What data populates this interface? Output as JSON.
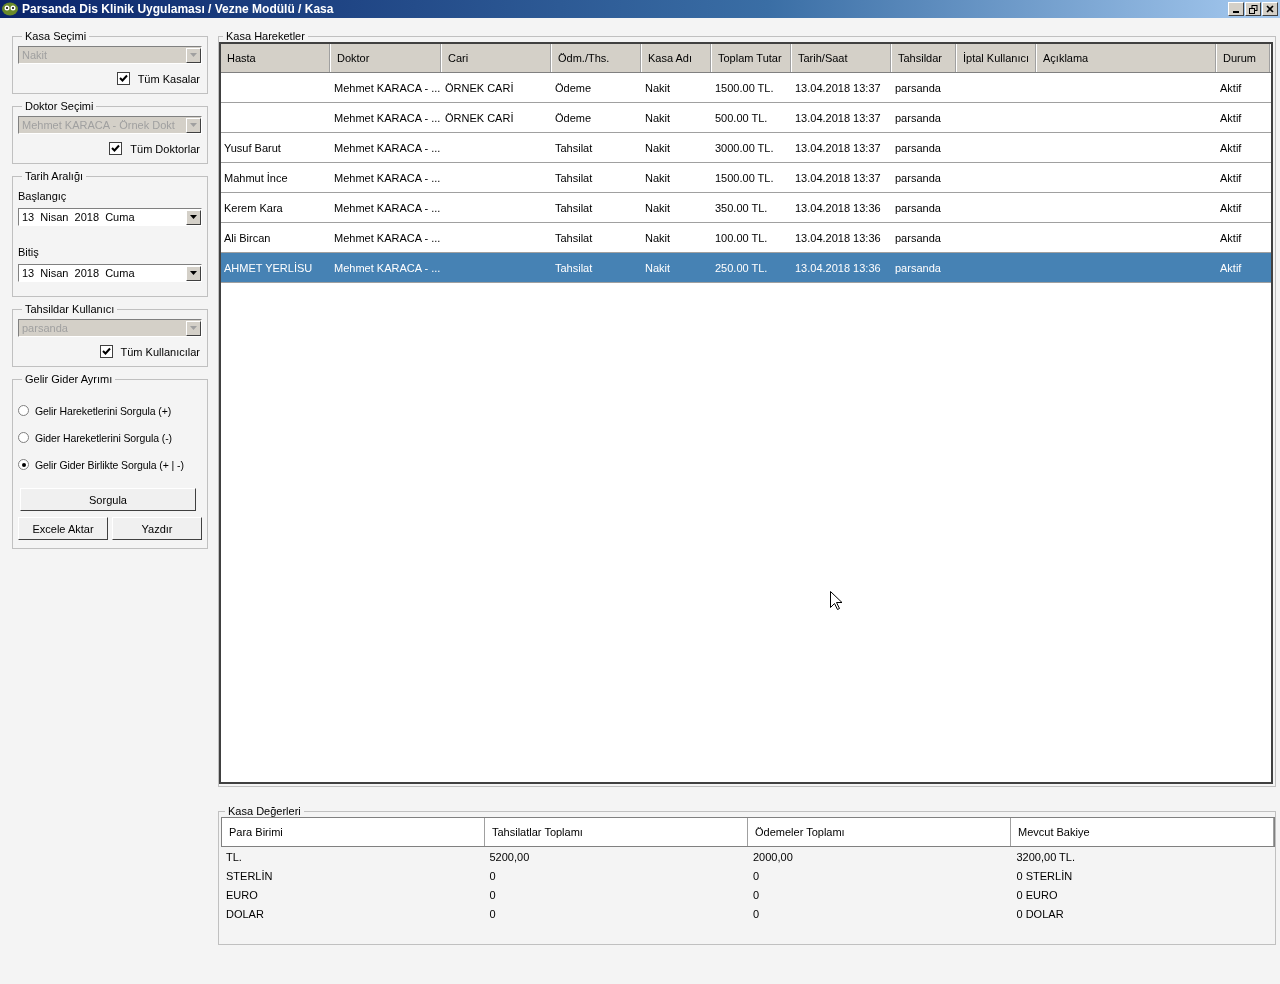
{
  "window": {
    "title": "Parsanda Dis Klinik Uygulaması / Vezne Modülü / Kasa"
  },
  "filter_groups": [
    {
      "kind": "select",
      "legend": "Kasa Seçimi",
      "value": "Nakit",
      "disabled": true,
      "checkbox": {
        "label": "Tüm Kasalar",
        "checked": true
      }
    },
    {
      "kind": "select",
      "legend": "Doktor Seçimi",
      "value": "Mehmet KARACA - Örnek Dokt",
      "disabled": true,
      "checkbox": {
        "label": "Tüm Doktorlar",
        "checked": true
      }
    },
    {
      "kind": "dates",
      "legend": "Tarih Aralığı",
      "fields": [
        {
          "label": "Başlangıç",
          "value": "13  Nisan  2018  Cuma"
        },
        {
          "label": "Bitiş",
          "value": "13  Nisan  2018  Cuma"
        }
      ]
    },
    {
      "kind": "select",
      "legend": "Tahsildar Kullanıcı",
      "value": "parsanda",
      "disabled": true,
      "checkbox": {
        "label": "Tüm Kullanıcılar",
        "checked": true
      }
    },
    {
      "kind": "radios",
      "legend": "Gelir Gider Ayrımı",
      "options": [
        {
          "label": "Gelir Hareketlerini Sorgula (+)",
          "selected": false
        },
        {
          "label": "Gider Hareketlerini Sorgula (-)",
          "selected": false
        },
        {
          "label": "Gelir Gider Birlikte Sorgula (+ | -)",
          "selected": true
        }
      ],
      "primary_button": "Sorgula",
      "buttons": [
        "Excele Aktar",
        "Yazdır"
      ]
    }
  ],
  "movements": {
    "legend": "Kasa Hareketler",
    "columns": [
      "Hasta",
      "Doktor",
      "Cari",
      "Ödm./Ths.",
      "Kasa Adı",
      "Toplam Tutar",
      "Tarih/Saat",
      "Tahsildar",
      "İptal Kullanıcı",
      "Açıklama",
      "Durum"
    ],
    "rows": [
      {
        "cells": [
          "",
          "Mehmet KARACA - ...",
          "ÖRNEK CARİ",
          "Ödeme",
          "Nakit",
          "1500.00 TL.",
          "13.04.2018 13:37",
          "parsanda",
          "",
          "",
          "Aktif"
        ],
        "selected": false
      },
      {
        "cells": [
          "",
          "Mehmet KARACA - ...",
          "ÖRNEK CARİ",
          "Ödeme",
          "Nakit",
          "500.00 TL.",
          "13.04.2018 13:37",
          "parsanda",
          "",
          "",
          "Aktif"
        ],
        "selected": false
      },
      {
        "cells": [
          "Yusuf Barut",
          "Mehmet KARACA - ...",
          "",
          "Tahsilat",
          "Nakit",
          "3000.00 TL.",
          "13.04.2018 13:37",
          "parsanda",
          "",
          "",
          "Aktif"
        ],
        "selected": false
      },
      {
        "cells": [
          "Mahmut İnce",
          "Mehmet KARACA - ...",
          "",
          "Tahsilat",
          "Nakit",
          "1500.00 TL.",
          "13.04.2018 13:37",
          "parsanda",
          "",
          "",
          "Aktif"
        ],
        "selected": false
      },
      {
        "cells": [
          "Kerem Kara",
          "Mehmet KARACA - ...",
          "",
          "Tahsilat",
          "Nakit",
          "350.00 TL.",
          "13.04.2018 13:36",
          "parsanda",
          "",
          "",
          "Aktif"
        ],
        "selected": false
      },
      {
        "cells": [
          "Ali Bircan",
          "Mehmet KARACA - ...",
          "",
          "Tahsilat",
          "Nakit",
          "100.00 TL.",
          "13.04.2018 13:36",
          "parsanda",
          "",
          "",
          "Aktif"
        ],
        "selected": false
      },
      {
        "cells": [
          "AHMET YERLİSU",
          "Mehmet KARACA - ...",
          "",
          "Tahsilat",
          "Nakit",
          "250.00 TL.",
          "13.04.2018 13:36",
          "parsanda",
          "",
          "",
          "Aktif"
        ],
        "selected": true
      }
    ]
  },
  "balances": {
    "legend": "Kasa Değerleri",
    "columns": [
      "Para Birimi",
      "Tahsilatlar Toplamı",
      "Ödemeler Toplamı",
      "Mevcut Bakiye"
    ],
    "rows": [
      [
        "TL.",
        "5200,00",
        "2000,00",
        "3200,00 TL."
      ],
      [
        "STERLİN",
        "0",
        "0",
        "0 STERLİN"
      ],
      [
        "EURO",
        "0",
        "0",
        "0 EURO"
      ],
      [
        "DOLAR",
        "0",
        "0",
        "0 DOLAR"
      ]
    ]
  }
}
